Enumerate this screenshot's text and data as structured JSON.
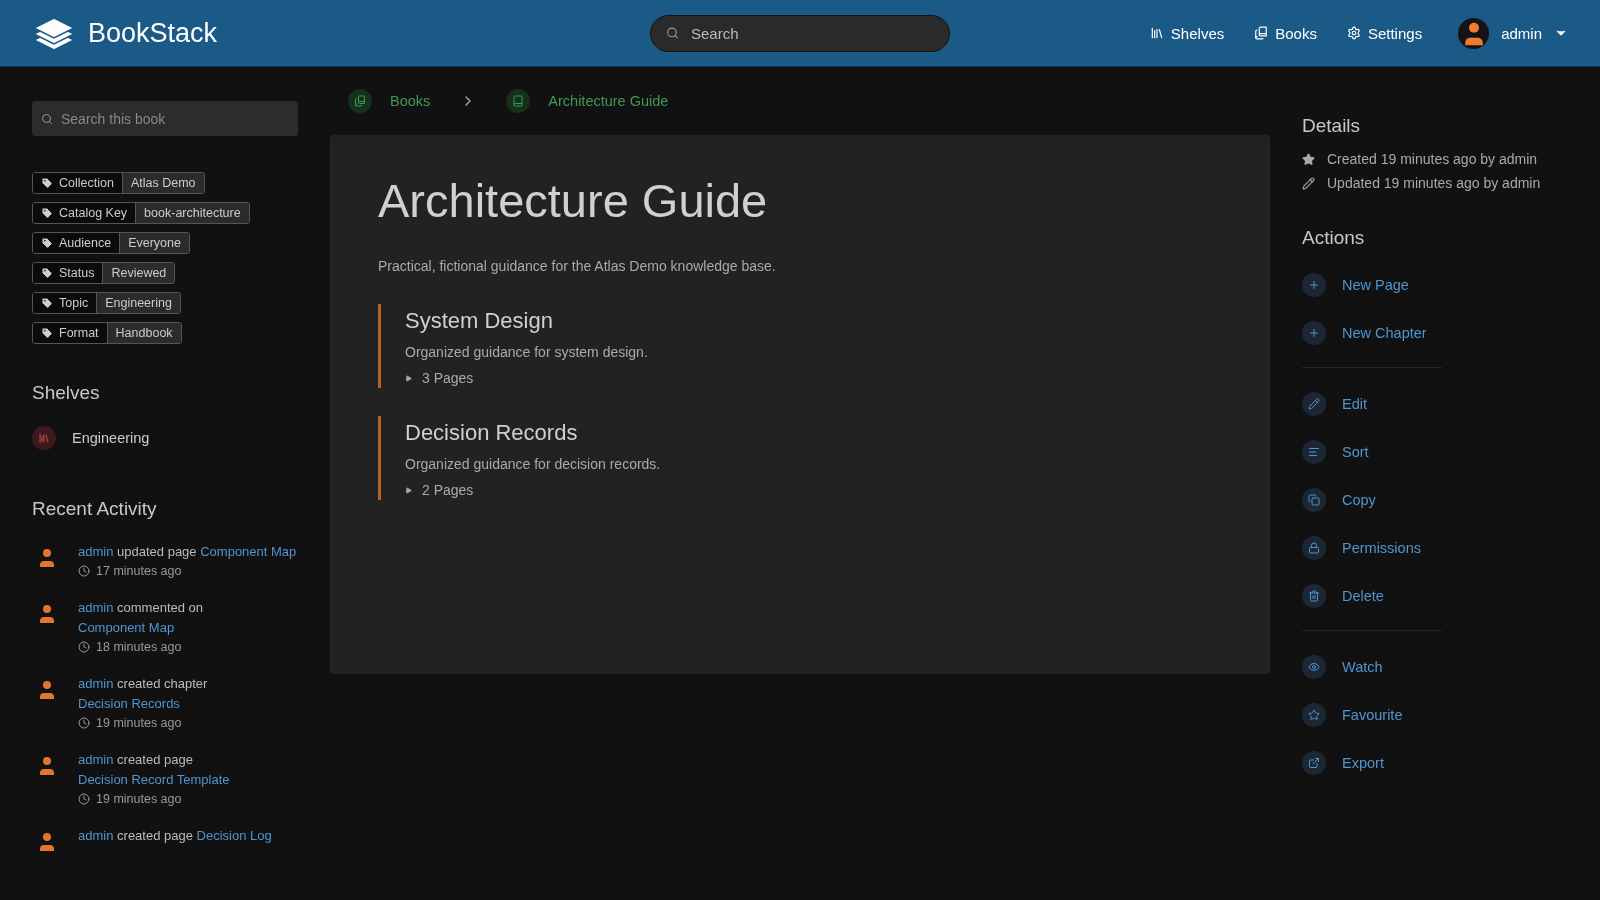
{
  "header": {
    "app_name": "BookStack",
    "search": {
      "placeholder": "Search"
    },
    "nav": [
      {
        "label": "Shelves",
        "kind": "shelves"
      },
      {
        "label": "Books",
        "kind": "books"
      },
      {
        "label": "Settings",
        "kind": "settings"
      }
    ],
    "user": {
      "name": "admin"
    }
  },
  "sidebar": {
    "search": {
      "placeholder": "Search this book"
    },
    "tags": [
      {
        "name": "Collection",
        "value": "Atlas Demo"
      },
      {
        "name": "Catalog Key",
        "value": "book-architecture"
      },
      {
        "name": "Audience",
        "value": "Everyone"
      },
      {
        "name": "Status",
        "value": "Reviewed"
      },
      {
        "name": "Topic",
        "value": "Engineering"
      },
      {
        "name": "Format",
        "value": "Handbook"
      }
    ],
    "shelves": {
      "title": "Shelves",
      "items": [
        {
          "name": "Engineering"
        }
      ]
    },
    "recent_activity": {
      "title": "Recent Activity",
      "items": [
        {
          "user": "admin",
          "action": "updated page",
          "target": "Component Map",
          "time": "17 minutes ago"
        },
        {
          "user": "admin",
          "action": "commented on",
          "target": "Component Map",
          "time": "18 minutes ago"
        },
        {
          "user": "admin",
          "action": "created chapter",
          "target": "Decision Records",
          "time": "19 minutes ago"
        },
        {
          "user": "admin",
          "action": "created page",
          "target": "Decision Record Template",
          "time": "19 minutes ago"
        },
        {
          "user": "admin",
          "action": "created page",
          "target": "Decision Log"
        }
      ]
    }
  },
  "breadcrumbs": [
    {
      "label": "Books",
      "kind": "books"
    },
    {
      "label": "Architecture Guide",
      "kind": "book"
    }
  ],
  "book": {
    "title": "Architecture Guide",
    "description": "Practical, fictional guidance for the Atlas Demo knowledge base.",
    "chapters": [
      {
        "title": "System Design",
        "description": "Organized guidance for system design.",
        "pages": "3 Pages",
        "expanded": false
      },
      {
        "title": "Decision Records",
        "description": "Organized guidance for decision records.",
        "pages": "2 Pages",
        "expanded": false
      }
    ]
  },
  "details": {
    "title": "Details",
    "items": [
      {
        "kind": "created",
        "text": "Created 19 minutes ago by admin"
      },
      {
        "kind": "updated",
        "text": "Updated 19 minutes ago by admin"
      }
    ]
  },
  "actions": {
    "title": "Actions",
    "groups": [
      {
        "items": [
          {
            "label": "New Page",
            "kind": "new"
          },
          {
            "label": "New Chapter",
            "kind": "new"
          }
        ]
      },
      {
        "items": [
          {
            "label": "Edit",
            "kind": "edit"
          },
          {
            "label": "Sort",
            "kind": "sort"
          },
          {
            "label": "Copy",
            "kind": "copy"
          },
          {
            "label": "Permissions",
            "kind": "permissions"
          },
          {
            "label": "Delete",
            "kind": "delete"
          }
        ]
      },
      {
        "items": [
          {
            "label": "Watch",
            "kind": "watch"
          },
          {
            "label": "Favourite",
            "kind": "favourite"
          },
          {
            "label": "Export",
            "kind": "export"
          }
        ]
      }
    ]
  }
}
